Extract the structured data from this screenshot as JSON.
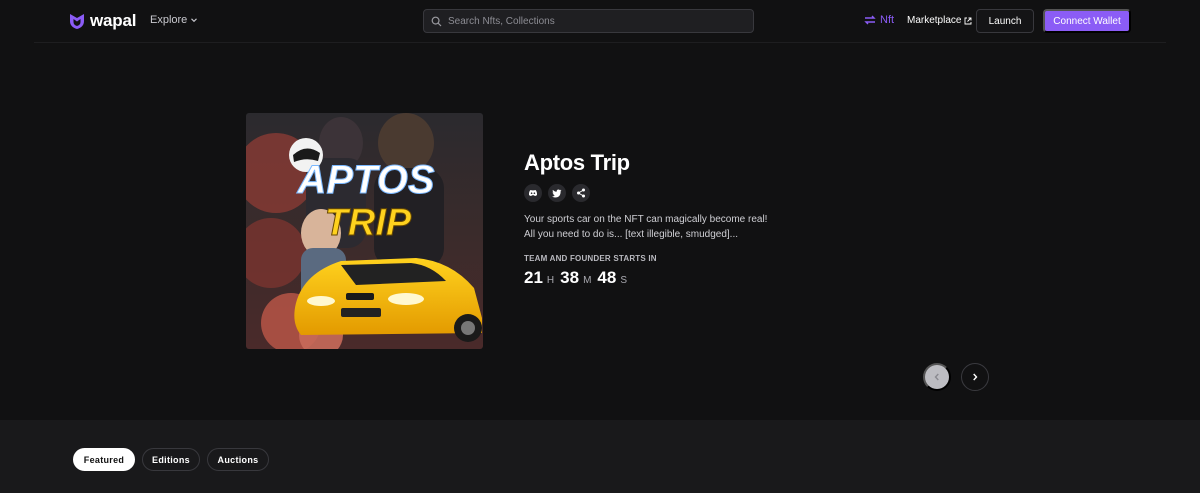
{
  "header": {
    "brand": "wapal",
    "explore_label": "Explore",
    "search": {
      "placeholder": "Search Nfts, Collections",
      "value": ""
    },
    "nft_toggle_label": "Nft",
    "marketplace_label": "Marketplace",
    "launch_label": "Launch",
    "connect_label": "Connect Wallet"
  },
  "hero": {
    "artwork": {
      "title_line_1": "APTOS",
      "title_line_2": "TRIP"
    },
    "title": "Aptos Trip",
    "socials": [
      "discord-icon",
      "twitter-icon",
      "share-icon"
    ],
    "description_line_1": "Your sports car on the NFT can magically become real!",
    "description_line_2": "All you need to do is... [text illegible, smudged]...",
    "phase_label": "TEAM AND FOUNDER STARTS IN",
    "countdown": {
      "hours": "21",
      "hours_unit": "H",
      "minutes": "38",
      "minutes_unit": "M",
      "seconds": "48",
      "seconds_unit": "S"
    }
  },
  "tabs": [
    {
      "label": "Featured",
      "active": true
    },
    {
      "label": "Editions",
      "active": false
    },
    {
      "label": "Auctions",
      "active": false
    }
  ],
  "colors": {
    "accent": "#8b5cf6",
    "background": "#111112",
    "section_bg": "#19191b"
  }
}
